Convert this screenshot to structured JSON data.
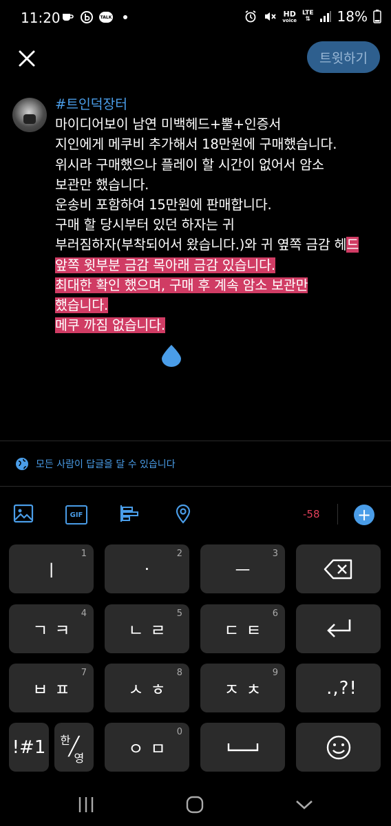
{
  "status": {
    "time": "11:20",
    "network_hd": "HD",
    "network_voice": "voice",
    "network_lte": "LTE",
    "battery": "18%",
    "talk_badge": "TALK"
  },
  "header": {
    "tweet_button": "트윗하기"
  },
  "compose": {
    "lines": [
      {
        "parts": [
          {
            "t": "#트인덕장터",
            "c": "hashtag"
          }
        ]
      },
      {
        "parts": [
          {
            "t": "마이디어보이 남연 미백헤드+뿔+인증서",
            "c": ""
          }
        ]
      },
      {
        "parts": [
          {
            "t": "지인에게 메쿠비 추가해서 18만원에 구매했습니다.",
            "c": ""
          }
        ]
      },
      {
        "parts": [
          {
            "t": "위시라 구매했으나 플레이 할 시간이 없어서 암소",
            "c": ""
          }
        ]
      },
      {
        "parts": [
          {
            "t": "보관만 했습니다.",
            "c": ""
          }
        ]
      },
      {
        "parts": [
          {
            "t": "운송비 포함하여 15만원에 판매합니다.",
            "c": ""
          }
        ]
      },
      {
        "parts": [
          {
            "t": "구매 할 당시부터 있던 하자는 귀",
            "c": ""
          }
        ]
      },
      {
        "parts": [
          {
            "t": "부러짐하자(부착되어서 왔습니다.)와 귀 옆쪽 금감 헤",
            "c": ""
          },
          {
            "t": "드",
            "c": "sel"
          }
        ]
      },
      {
        "parts": [
          {
            "t": "앞쪽 윗부분 금감 목아래 금감 있습니다.",
            "c": "sel"
          }
        ]
      },
      {
        "parts": [
          {
            "t": "최대한 확인 했으며, 구매 후 계속 암소 보관만",
            "c": "sel"
          }
        ]
      },
      {
        "parts": [
          {
            "t": "했습니다.",
            "c": "sel"
          }
        ]
      },
      {
        "parts": [
          {
            "t": "메쿠 까짐 없습니다.",
            "c": "sel"
          }
        ]
      }
    ]
  },
  "reply_setting": "모든 사람이 답글을 달 수 있습니다",
  "toolbar": {
    "gif_label": "GIF",
    "counter": "-58",
    "add": "+"
  },
  "keyboard": {
    "keys": [
      {
        "label": "ㅣ",
        "num": "1",
        "name": "key-1"
      },
      {
        "label": "·",
        "num": "2",
        "name": "key-2"
      },
      {
        "label": "ㅡ",
        "num": "3",
        "name": "key-3"
      },
      {
        "label": "",
        "num": "",
        "name": "backspace-key"
      },
      {
        "label": "ㄱㅋ",
        "num": "4",
        "name": "key-4"
      },
      {
        "label": "ㄴㄹ",
        "num": "5",
        "name": "key-5"
      },
      {
        "label": "ㄷㅌ",
        "num": "6",
        "name": "key-6"
      },
      {
        "label": "",
        "num": "",
        "name": "enter-key"
      },
      {
        "label": "ㅂㅍ",
        "num": "7",
        "name": "key-7"
      },
      {
        "label": "ㅅㅎ",
        "num": "8",
        "name": "key-8"
      },
      {
        "label": "ㅈㅊ",
        "num": "9",
        "name": "key-9"
      },
      {
        "label": ".,?!",
        "num": "",
        "name": "punctuation-key"
      },
      {
        "label": "!#1",
        "num": "",
        "name": "symbol-key"
      },
      {
        "label": "",
        "num": "",
        "name": "lang-switch-key"
      },
      {
        "label": "ㅇㅁ",
        "num": "0",
        "name": "key-0"
      },
      {
        "label": "",
        "num": "",
        "name": "space-key"
      },
      {
        "label": "",
        "num": "",
        "name": "emoji-key"
      }
    ],
    "lang_top": "한",
    "lang_bottom": "영"
  }
}
